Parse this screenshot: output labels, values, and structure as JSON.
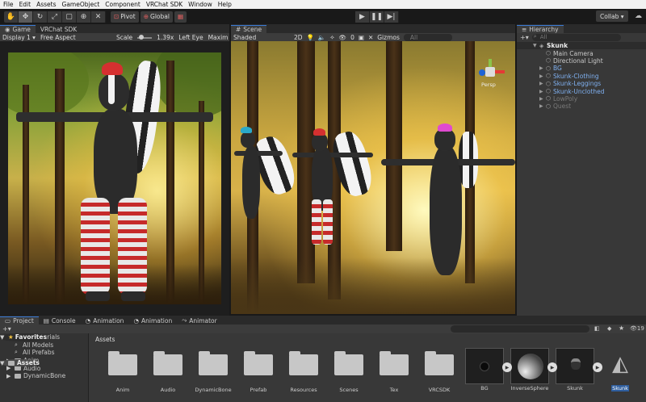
{
  "menu": [
    "File",
    "Edit",
    "Assets",
    "GameObject",
    "Component",
    "VRChat SDK",
    "Window",
    "Help"
  ],
  "toolbar": {
    "tools": [
      "hand-tool",
      "move-tool",
      "rotate-tool",
      "scale-tool",
      "rect-tool",
      "transform-tool",
      "custom-tool"
    ],
    "pivot_label": "Pivot",
    "global_label": "Global",
    "collab_label": "Collab ▾"
  },
  "game_panel": {
    "tabs": [
      "Game",
      "VRChat SDK"
    ],
    "display": "Display 1 ▾",
    "aspect": "Free Aspect",
    "scale_label": "Scale",
    "scale_value": "1.39x",
    "eye": "Left Eye",
    "maximize": "Maxim"
  },
  "scene_panel": {
    "tab": "Scene",
    "shading": "Shaded",
    "mode_2d": "2D",
    "fx_count": "0",
    "gizmos": "Gizmos",
    "search_placeholder": "All",
    "persp_label": "Persp"
  },
  "hierarchy": {
    "tab": "Hierarchy",
    "search_placeholder": "All",
    "root": "Skunk",
    "items": [
      {
        "label": "Main Camera",
        "style": "normal",
        "expand": false
      },
      {
        "label": "Directional Light",
        "style": "normal",
        "expand": false
      },
      {
        "label": "BG",
        "style": "blue",
        "expand": true
      },
      {
        "label": "Skunk-Clothing",
        "style": "blue",
        "expand": true
      },
      {
        "label": "Skunk-Leggings",
        "style": "blue",
        "expand": true
      },
      {
        "label": "Skunk-Unclothed",
        "style": "blue",
        "expand": true
      },
      {
        "label": "LowPoly",
        "style": "dim",
        "expand": true
      },
      {
        "label": "Quest",
        "style": "dim",
        "expand": true
      }
    ]
  },
  "project": {
    "tabs": [
      "Project",
      "Console",
      "Animation",
      "Animation",
      "Animator"
    ],
    "hidden_count": "19",
    "favorites_label": "Favorites",
    "favorites": [
      "All Materials",
      "All Models",
      "All Prefabs"
    ],
    "assets_label": "Assets",
    "tree_children": [
      "Anim",
      "Audio",
      "DynamicBone"
    ],
    "breadcrumb": "Assets",
    "folders": [
      "Anim",
      "Audio",
      "DynamicBone",
      "Prefab",
      "Resources",
      "Scenes",
      "Tex",
      "VRCSDK"
    ],
    "prefabs": [
      "BG",
      "InverseSphere",
      "Skunk",
      "Skunk"
    ]
  }
}
